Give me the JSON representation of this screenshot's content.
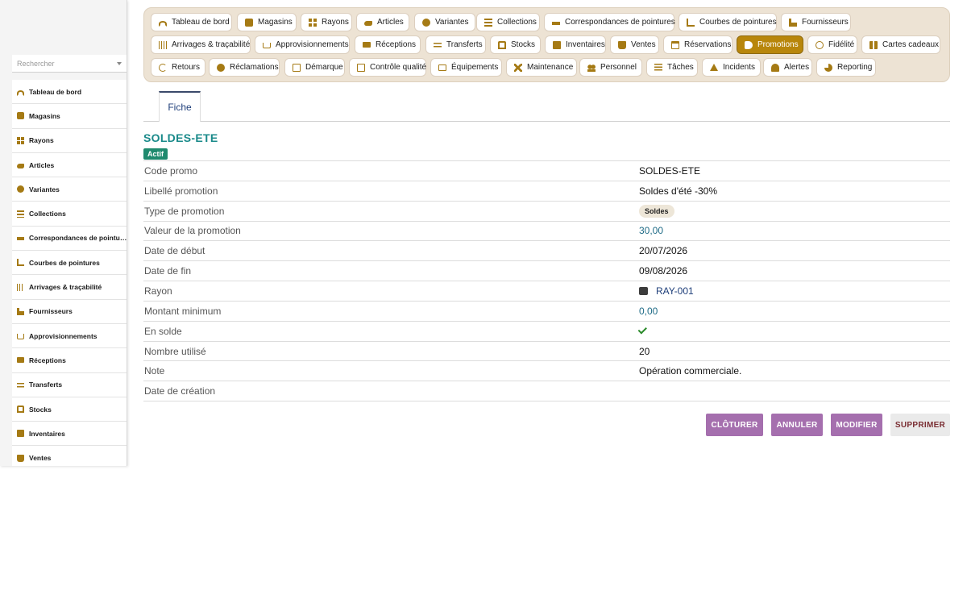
{
  "sidebar": {
    "search_placeholder": "Rechercher",
    "items": [
      {
        "label": "Tableau de bord",
        "icon": "gauge-icon"
      },
      {
        "label": "Magasins",
        "icon": "store-icon"
      },
      {
        "label": "Rayons",
        "icon": "grid-icon"
      },
      {
        "label": "Articles",
        "icon": "shoe-icon"
      },
      {
        "label": "Variantes",
        "icon": "palette-icon"
      },
      {
        "label": "Collections",
        "icon": "layers-icon"
      },
      {
        "label": "Correspondances de pointures",
        "icon": "ruler-icon"
      },
      {
        "label": "Courbes de pointures",
        "icon": "chart-icon"
      },
      {
        "label": "Arrivages & traçabilité",
        "icon": "barcode-icon"
      },
      {
        "label": "Fournisseurs",
        "icon": "factory-icon"
      },
      {
        "label": "Approvisionnements",
        "icon": "cart-icon"
      },
      {
        "label": "Réceptions",
        "icon": "truck-icon"
      },
      {
        "label": "Transferts",
        "icon": "swap-icon"
      },
      {
        "label": "Stocks",
        "icon": "warehouse-icon"
      },
      {
        "label": "Inventaires",
        "icon": "clipboard-icon"
      },
      {
        "label": "Ventes",
        "icon": "bag-icon"
      }
    ]
  },
  "topnav": {
    "accent": "#b8860b",
    "active": "Promotions",
    "rows": [
      [
        {
          "label": "Tableau de bord",
          "icon": "gauge-icon"
        },
        {
          "label": "Magasins",
          "icon": "store-icon"
        },
        {
          "label": "Rayons",
          "icon": "grid-icon"
        },
        {
          "label": "Articles",
          "icon": "shoe-icon"
        },
        {
          "label": "Variantes",
          "icon": "palette-icon"
        },
        {
          "label": "Collections",
          "icon": "layers-icon"
        },
        {
          "label": "Correspondances de pointures",
          "icon": "ruler-icon"
        },
        {
          "label": "Courbes de pointures",
          "icon": "chart-icon"
        },
        {
          "label": "Fournisseurs",
          "icon": "factory-icon"
        }
      ],
      [
        {
          "label": "Arrivages & traçabilité",
          "icon": "barcode-icon"
        },
        {
          "label": "Approvisionnements",
          "icon": "cart-icon"
        },
        {
          "label": "Réceptions",
          "icon": "truck-icon"
        },
        {
          "label": "Transferts",
          "icon": "swap-icon"
        },
        {
          "label": "Stocks",
          "icon": "warehouse-icon"
        },
        {
          "label": "Inventaires",
          "icon": "clipboard-icon"
        },
        {
          "label": "Ventes",
          "icon": "bag-icon"
        },
        {
          "label": "Réservations",
          "icon": "calendar-check-icon"
        },
        {
          "label": "Promotions",
          "icon": "tag-icon"
        },
        {
          "label": "Fidélité",
          "icon": "award-icon"
        },
        {
          "label": "Cartes cadeaux",
          "icon": "gift-icon"
        }
      ],
      [
        {
          "label": "Retours",
          "icon": "undo-icon"
        },
        {
          "label": "Réclamations",
          "icon": "comment-icon"
        },
        {
          "label": "Démarque",
          "icon": "file-icon"
        },
        {
          "label": "Contrôle qualité",
          "icon": "file-check-icon"
        },
        {
          "label": "Équipements",
          "icon": "monitor-icon"
        },
        {
          "label": "Maintenance",
          "icon": "tools-icon"
        },
        {
          "label": "Personnel",
          "icon": "users-icon"
        },
        {
          "label": "Tâches",
          "icon": "tasks-icon"
        },
        {
          "label": "Incidents",
          "icon": "warning-icon"
        },
        {
          "label": "Alertes",
          "icon": "bell-icon"
        },
        {
          "label": "Reporting",
          "icon": "pie-chart-icon"
        }
      ]
    ]
  },
  "tabs": [
    {
      "label": "Fiche",
      "active": true
    }
  ],
  "record": {
    "title": "SOLDES-ETE",
    "status": "Actif",
    "status_color": "#1f8a6e",
    "fields": [
      {
        "label": "Code promo",
        "value": "SOLDES-ETE",
        "kind": "text"
      },
      {
        "label": "Libellé promotion",
        "value": "Soldes d'été -30%",
        "kind": "text"
      },
      {
        "label": "Type de promotion",
        "value": "Soldes",
        "kind": "pill"
      },
      {
        "label": "Valeur de la promotion",
        "value": "30,00",
        "kind": "num"
      },
      {
        "label": "Date de début",
        "value": "20/07/2026",
        "kind": "text"
      },
      {
        "label": "Date de fin",
        "value": "09/08/2026",
        "kind": "text"
      },
      {
        "label": "Rayon",
        "value": "RAY-001",
        "kind": "link",
        "icon": "rayon-icon"
      },
      {
        "label": "Montant minimum",
        "value": "0,00",
        "kind": "num"
      },
      {
        "label": "En solde",
        "value": "",
        "kind": "check",
        "icon": "checkmark-icon"
      },
      {
        "label": "Nombre utilisé",
        "value": "20",
        "kind": "text"
      },
      {
        "label": "Note",
        "value": "Opération commerciale.",
        "kind": "text"
      },
      {
        "label": "Date de création",
        "value": "",
        "kind": "text"
      }
    ]
  },
  "actions": {
    "close": "CLÔTURER",
    "cancel": "ANNULER",
    "edit": "MODIFIER",
    "delete": "SUPPRIMER",
    "primary_color": "#a56fae"
  }
}
